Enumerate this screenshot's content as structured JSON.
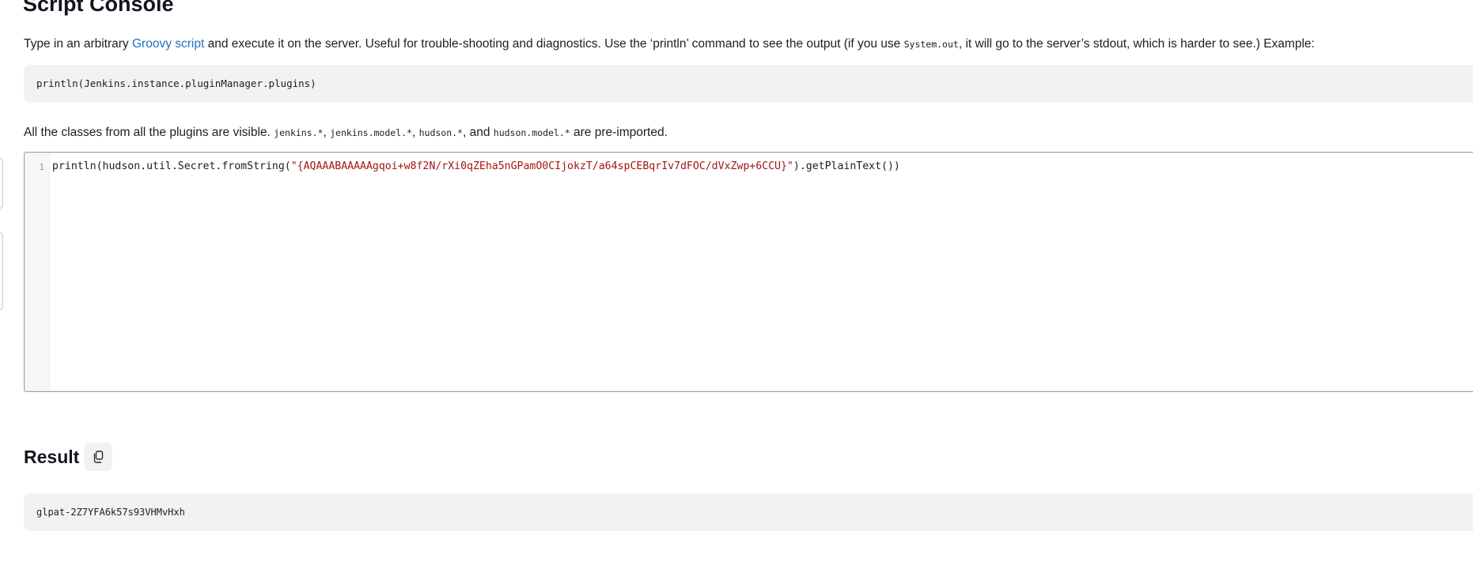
{
  "page": {
    "title": "Script Console"
  },
  "intro": {
    "before_link": "Type in an arbitrary ",
    "link_text": "Groovy script",
    "after_link": " and execute it on the server. Useful for trouble-shooting and diagnostics. Use the ‘println’ command to see the output (if you use ",
    "code": "System.out",
    "after_code": ", it will go to the server’s stdout, which is harder to see.) Example:"
  },
  "example": {
    "code": "println(Jenkins.instance.pluginManager.plugins)"
  },
  "preimport": {
    "text_1": "All the classes from all the plugins are visible. ",
    "code_1": "jenkins.*",
    "sep_1": ", ",
    "code_2": "jenkins.model.*",
    "sep_2": ", ",
    "code_3": "hudson.*",
    "sep_3": ", and ",
    "code_4": "hudson.model.*",
    "text_2": " are pre-imported."
  },
  "editor": {
    "line_number": "1",
    "code_prefix": "println(hudson.util.Secret.fromString(",
    "code_string": "\"{AQAAABAAAAAgqoi+w8f2N/rXi0qZEha5nGPamO0CIjokzT/a64spCEBqrIv7dFOC/dVxZwp+6CCU}\"",
    "code_suffix": ").getPlainText())"
  },
  "result": {
    "title": "Result",
    "copy_icon": "copy-icon",
    "output": "glpat-2Z7YFA6k57s93VHMvHxh"
  },
  "colors": {
    "link": "#1f6fc2",
    "string_literal": "#a11515",
    "code_background": "#f2f2f3"
  }
}
